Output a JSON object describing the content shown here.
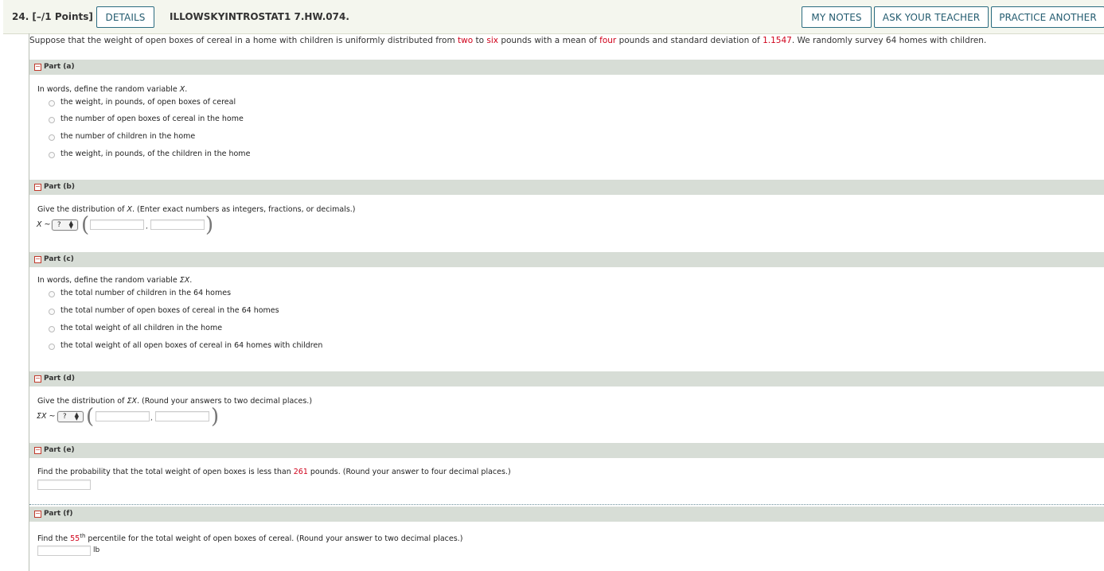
{
  "header": {
    "question_number": "24.  [–/1 Points]",
    "details_label": "DETAILS",
    "assignment_code": "ILLOWSKYINTROSTAT1 7.HW.074.",
    "my_notes_label": "MY NOTES",
    "ask_teacher_label": "ASK YOUR TEACHER",
    "practice_another_label": "PRACTICE ANOTHER"
  },
  "intro": {
    "t1": "Suppose that the weight of open boxes of cereal in a home with children is uniformly distributed from ",
    "v_two": "two",
    "t2": " to ",
    "v_six": "six",
    "t3": " pounds with a mean of ",
    "v_four": "four",
    "t4": " pounds and standard deviation of ",
    "v_sd": "1.1547",
    "t5": ". We randomly survey 64 homes with children."
  },
  "parts": {
    "a": {
      "label": "Part (a)",
      "prompt": "In words, define the random variable ",
      "prompt_var": "X",
      "prompt_end": ".",
      "options": [
        "the weight, in pounds, of open boxes of cereal",
        "the number of open boxes of cereal in the home",
        "the number of children in the home",
        "the weight, in pounds, of the children in the home"
      ]
    },
    "b": {
      "label": "Part (b)",
      "prompt": "Give the distribution of ",
      "prompt_var": "X",
      "prompt_end": ". (Enter exact numbers as integers, fractions, or decimals.)",
      "dist_label": "X ~",
      "select_value": "?",
      "comma": ","
    },
    "c": {
      "label": "Part (c)",
      "prompt": "In words, define the random variable ",
      "prompt_var": "ΣX",
      "prompt_end": ".",
      "options": [
        "the total number of children in the 64 homes",
        "the total number of open boxes of cereal in the 64 homes",
        "the total weight of all children in the home",
        "the total weight of all open boxes of cereal in 64 homes with children"
      ]
    },
    "d": {
      "label": "Part (d)",
      "prompt": "Give the distribution of ",
      "prompt_var": "ΣX",
      "prompt_end": ". (Round your answers to two decimal places.)",
      "dist_label": "ΣX ~",
      "select_value": "?",
      "comma": ","
    },
    "e": {
      "label": "Part (e)",
      "prompt": "Find the probability that the total weight of open boxes is less than ",
      "value": "261",
      "prompt_end": " pounds. (Round your answer to four decimal places.)"
    },
    "f": {
      "label": "Part (f)",
      "prompt": "Find the ",
      "value": "55",
      "sup": "th",
      "prompt_end": " percentile for the total weight of open boxes of cereal. (Round your answer to two decimal places.)",
      "unit": "lb"
    }
  },
  "colors": {
    "accent": "#2b6c80",
    "highlight": "#d0021b",
    "part_bar": "#d7ddd6",
    "header_bg": "#f4f6ee"
  }
}
